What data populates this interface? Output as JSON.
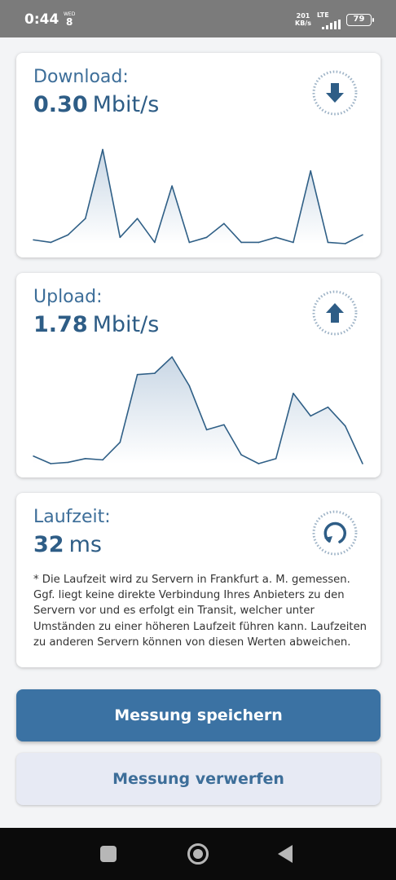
{
  "status_bar": {
    "time": "0:44",
    "day_name": "WED",
    "day_number": "8",
    "speed_value": "201",
    "speed_unit": "KB/s",
    "network": "LTE",
    "battery": "79"
  },
  "download": {
    "label": "Download:",
    "value": "0.30",
    "unit": "Mbit/s",
    "icon": "download-arrow-icon"
  },
  "upload": {
    "label": "Upload:",
    "value": "1.78",
    "unit": "Mbit/s",
    "icon": "upload-arrow-icon"
  },
  "latency": {
    "label": "Laufzeit:",
    "value": "32",
    "unit": "ms",
    "icon": "refresh-icon",
    "note": "* Die Laufzeit wird zu Servern in Frankfurt a. M. gemessen. Ggf. liegt keine direkte Verbindung Ihres Anbieters zu den Servern vor und es erfolgt ein Transit, welcher unter Umständen zu einer höheren Laufzeit führen kann. Laufzeiten zu anderen Servern können von diesen Werten abweichen."
  },
  "buttons": {
    "save": "Messung speichern",
    "discard": "Messung verwerfen"
  },
  "colors": {
    "accent": "#3b72a3",
    "text": "#2e5d86",
    "chart_line": "#2f5f86"
  },
  "chart_data": [
    {
      "type": "area",
      "series": [
        {
          "values": [
            0.03,
            0.01,
            0.07,
            0.2,
            0.75,
            0.05,
            0.2,
            0.01,
            0.46,
            0.01,
            0.05,
            0.16,
            0.01,
            0.01,
            0.05,
            0.01,
            0.58,
            0.01,
            0.0,
            0.07
          ]
        }
      ]
    },
    {
      "type": "area",
      "series": [
        {
          "values": [
            0.06,
            0.0,
            0.01,
            0.04,
            0.03,
            0.17,
            0.71,
            0.72,
            0.85,
            0.62,
            0.27,
            0.31,
            0.07,
            0.0,
            0.04,
            0.56,
            0.38,
            0.45,
            0.3,
            0.0
          ]
        }
      ]
    }
  ]
}
